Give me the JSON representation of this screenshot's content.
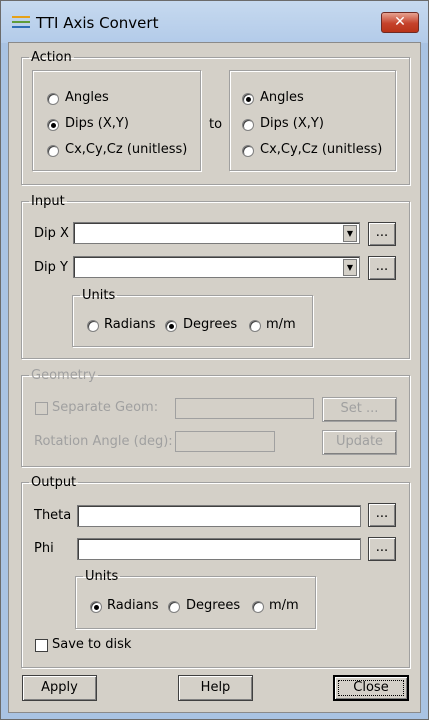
{
  "window": {
    "title": "TTI Axis Convert",
    "close_glyph": "✕"
  },
  "action": {
    "legend": "Action",
    "from_options": [
      "Angles",
      "Dips (X,Y)",
      "Cx,Cy,Cz (unitless)"
    ],
    "from_selected": "Dips (X,Y)",
    "to_label": "to",
    "to_options": [
      "Angles",
      "Dips (X,Y)",
      "Cx,Cy,Cz (unitless)"
    ],
    "to_selected": "Angles"
  },
  "input": {
    "legend": "Input",
    "dip_x_label": "Dip X",
    "dip_x_value": "",
    "dip_y_label": "Dip Y",
    "dip_y_value": "",
    "browse_label": "...",
    "units": {
      "legend": "Units",
      "options": [
        "Radians",
        "Degrees",
        "m/m"
      ],
      "selected": "Degrees"
    }
  },
  "geometry": {
    "legend": "Geometry",
    "separate_geom_label": "Separate Geom:",
    "separate_geom_checked": false,
    "separate_geom_value": "",
    "set_button": "Set ...",
    "rotation_label": "Rotation Angle (deg):",
    "rotation_value": "",
    "update_button": "Update"
  },
  "output": {
    "legend": "Output",
    "theta_label": "Theta",
    "theta_value": "",
    "phi_label": "Phi",
    "phi_value": "",
    "browse_label": "...",
    "units": {
      "legend": "Units",
      "options": [
        "Radians",
        "Degrees",
        "m/m"
      ],
      "selected": "Radians"
    },
    "save_to_disk_label": "Save to disk",
    "save_to_disk_checked": false
  },
  "buttons": {
    "apply": "Apply",
    "help": "Help",
    "close": "Close"
  },
  "icons": {
    "app": "tti-lines-icon",
    "dropdown": "chevron-down-icon",
    "close": "close-icon"
  },
  "colors": {
    "title_bar": "#b3cbe9",
    "close_button": "#c5422b",
    "dialog_bg": "#d4d0c8"
  }
}
